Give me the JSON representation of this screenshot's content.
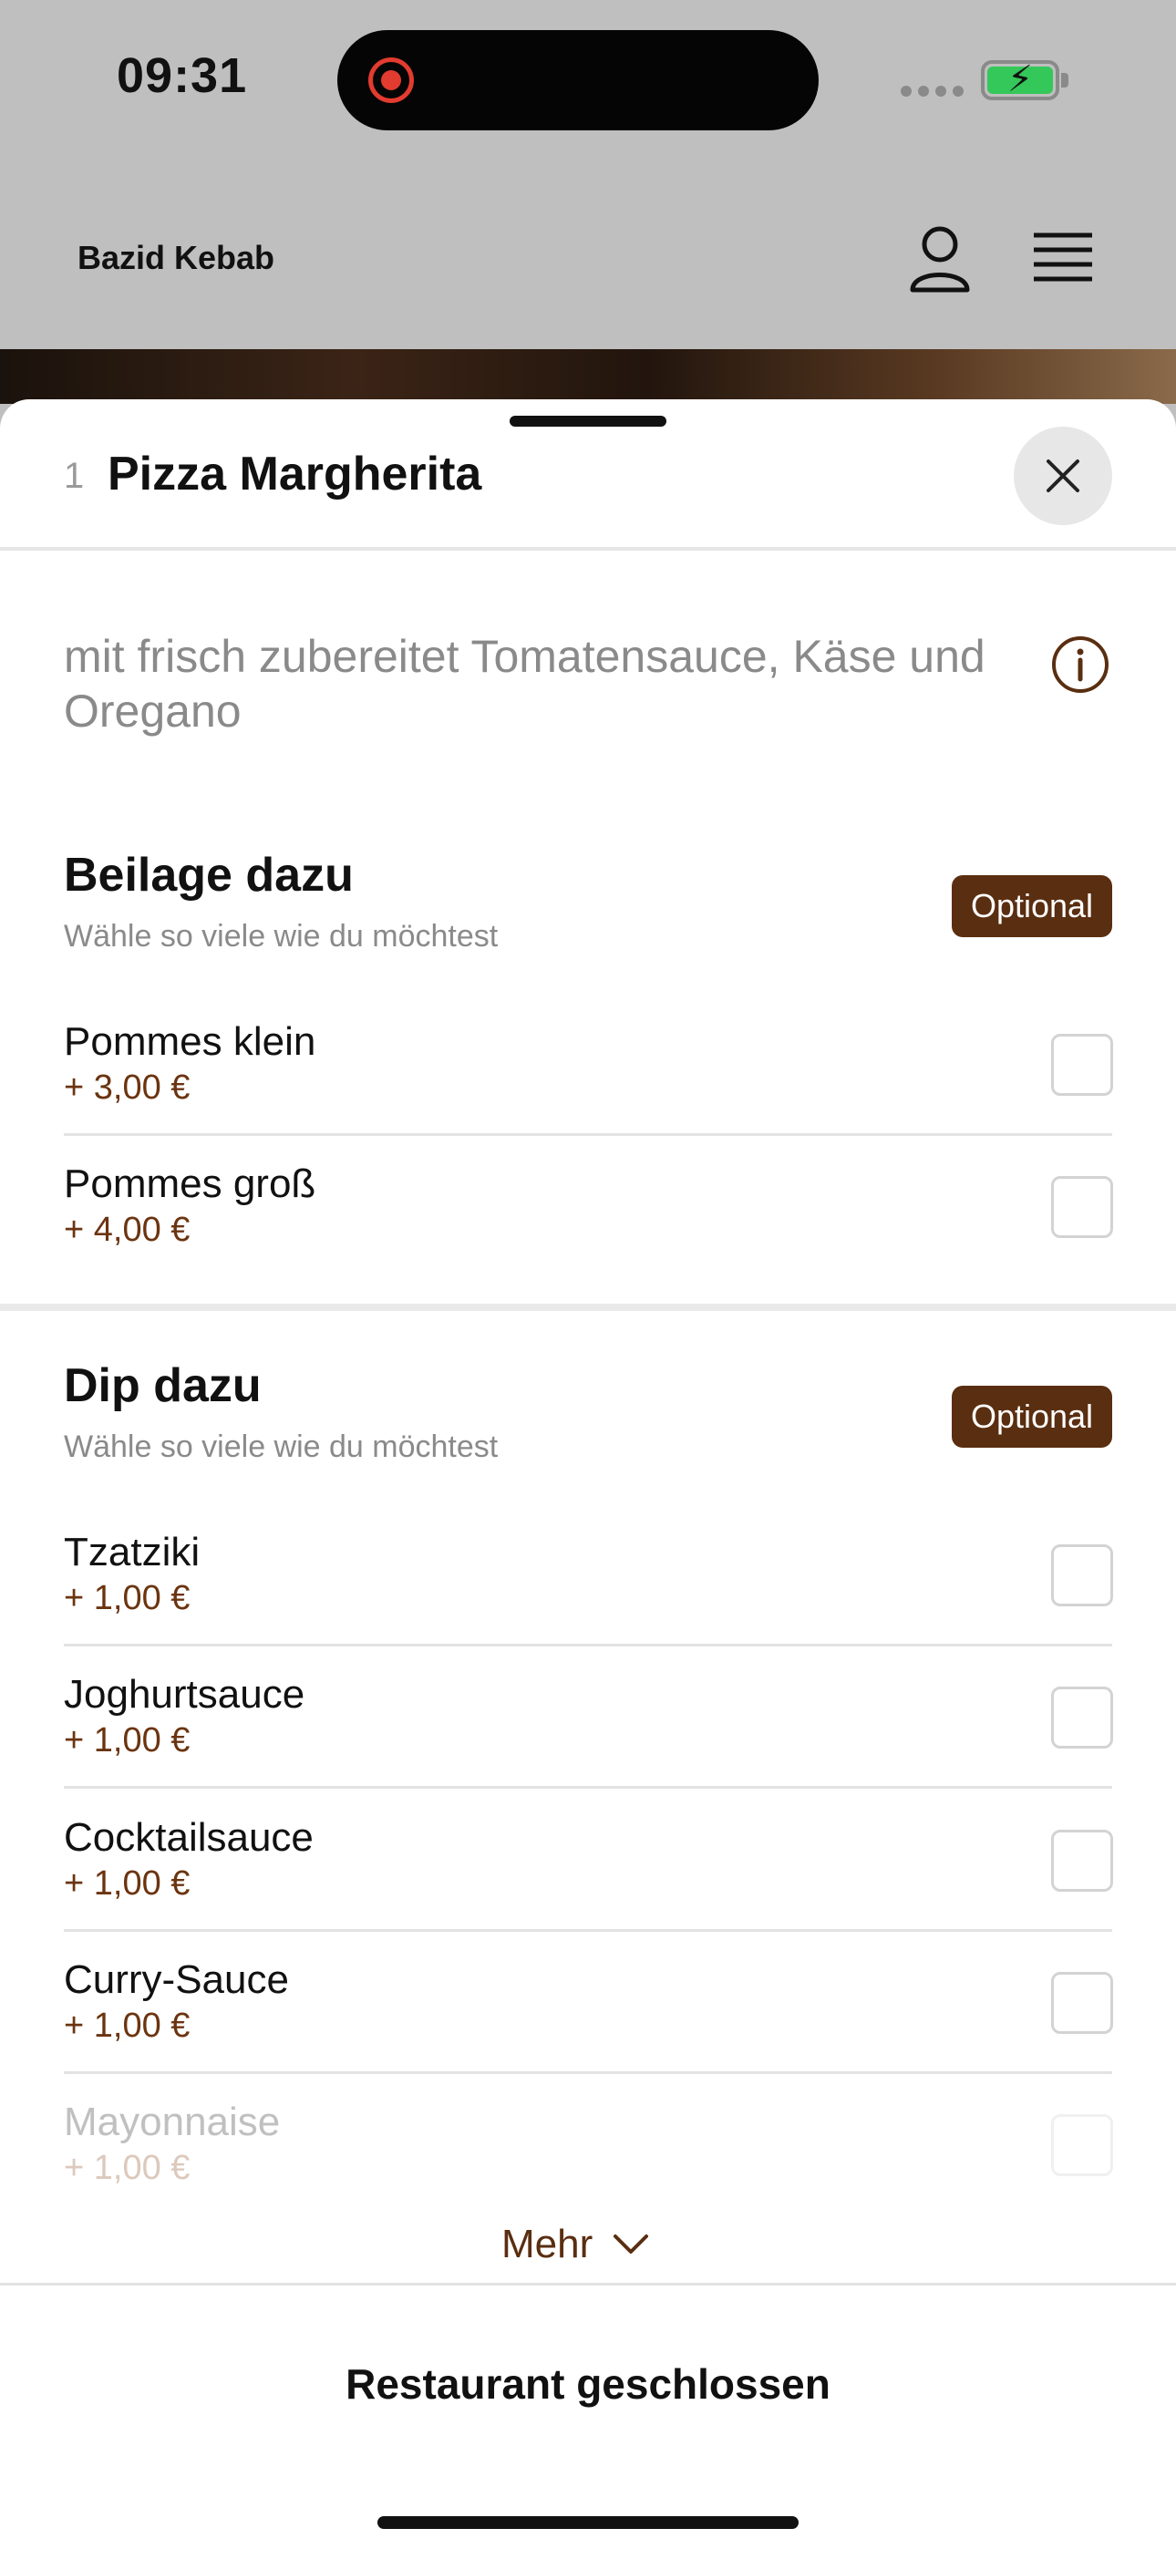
{
  "status_bar": {
    "time": "09:31"
  },
  "header": {
    "brand": "Bazid Kebab"
  },
  "sheet": {
    "quantity": "1",
    "title": "Pizza Margherita",
    "description": "mit frisch zubereitet Tomatensauce, Käse und Oregano",
    "groups": [
      {
        "title": "Beilage dazu",
        "subtitle": "Wähle so viele wie du möchtest",
        "badge": "Optional",
        "options": [
          {
            "name": "Pommes klein",
            "price": "+ 3,00 €",
            "checked": false
          },
          {
            "name": "Pommes groß",
            "price": "+ 4,00 €",
            "checked": false
          }
        ]
      },
      {
        "title": "Dip dazu",
        "subtitle": "Wähle so viele wie du möchtest",
        "badge": "Optional",
        "options": [
          {
            "name": "Tzatziki",
            "price": "+ 1,00 €",
            "checked": false
          },
          {
            "name": "Joghurtsauce",
            "price": "+ 1,00 €",
            "checked": false
          },
          {
            "name": "Cocktailsauce",
            "price": "+ 1,00 €",
            "checked": false
          },
          {
            "name": "Curry-Sauce",
            "price": "+ 1,00 €",
            "checked": false
          },
          {
            "name": "Mayonnaise",
            "price": "+ 1,00 €",
            "checked": false
          }
        ]
      }
    ],
    "more_label": "Mehr",
    "footer_label": "Restaurant geschlossen"
  },
  "colors": {
    "accent_brown": "#5a2e10",
    "price_brown": "#6b3410",
    "battery_green": "#34c759",
    "record_red": "#e23b2f"
  },
  "icons": [
    "record-icon",
    "battery-charging-icon",
    "user-icon",
    "menu-icon",
    "close-icon",
    "info-icon",
    "chevron-down-icon"
  ]
}
